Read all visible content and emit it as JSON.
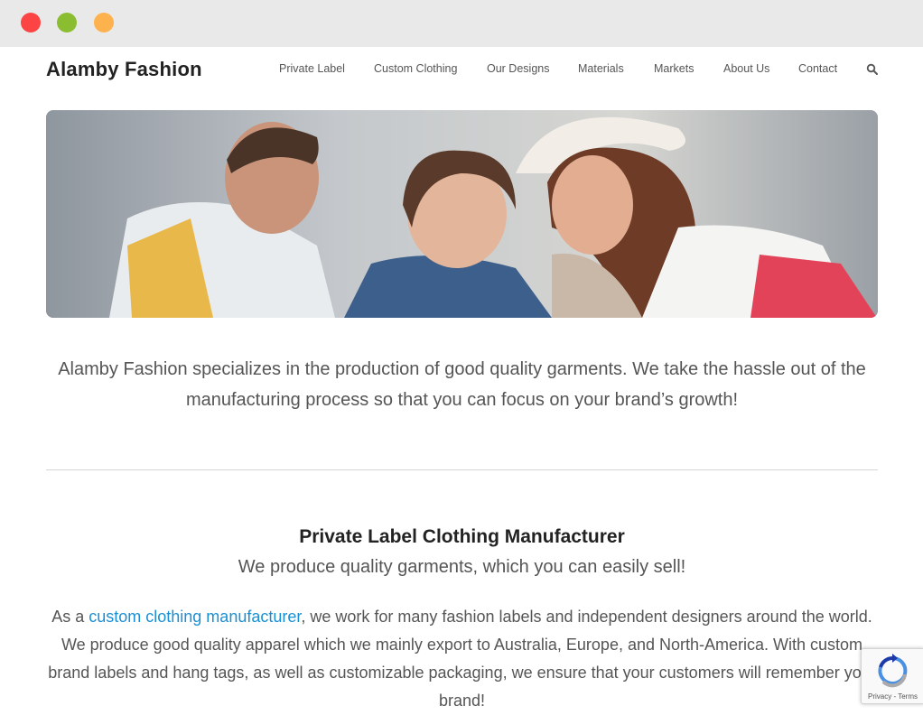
{
  "window": {
    "controls": [
      "close",
      "minimize",
      "maximize"
    ],
    "colors": {
      "close": "#fb4443",
      "minimize": "#8bbd31",
      "maximize": "#feb24d"
    }
  },
  "header": {
    "logo": "Alamby Fashion",
    "nav": [
      {
        "label": "Private Label"
      },
      {
        "label": "Custom Clothing"
      },
      {
        "label": "Our Designs"
      },
      {
        "label": "Materials"
      },
      {
        "label": "Markets"
      },
      {
        "label": "About Us"
      },
      {
        "label": "Contact"
      }
    ],
    "search_icon": "search-icon"
  },
  "hero": {
    "image": "family-shopping-photo"
  },
  "intro": {
    "text": "Alamby Fashion specializes in the production of good quality garments. We take the hassle out of the manufacturing process so that you can focus on your brand’s growth!"
  },
  "section": {
    "title": "Private Label Clothing Manufacturer",
    "subtitle": "We produce quality garments, which you can easily sell!",
    "body_prefix": "As a ",
    "body_link": "custom clothing manufacturer",
    "body_suffix": ", we work for many fashion labels and independent designers around the world. We produce good quality apparel which we mainly export to Australia, Europe, and North-America. With custom brand labels and hang tags, as well as customizable packaging, we ensure that your customers will remember your brand!"
  },
  "recaptcha": {
    "links": "Privacy - Terms"
  },
  "colors": {
    "link": "#1a8fd4",
    "text": "#555555",
    "heading": "#222222"
  }
}
